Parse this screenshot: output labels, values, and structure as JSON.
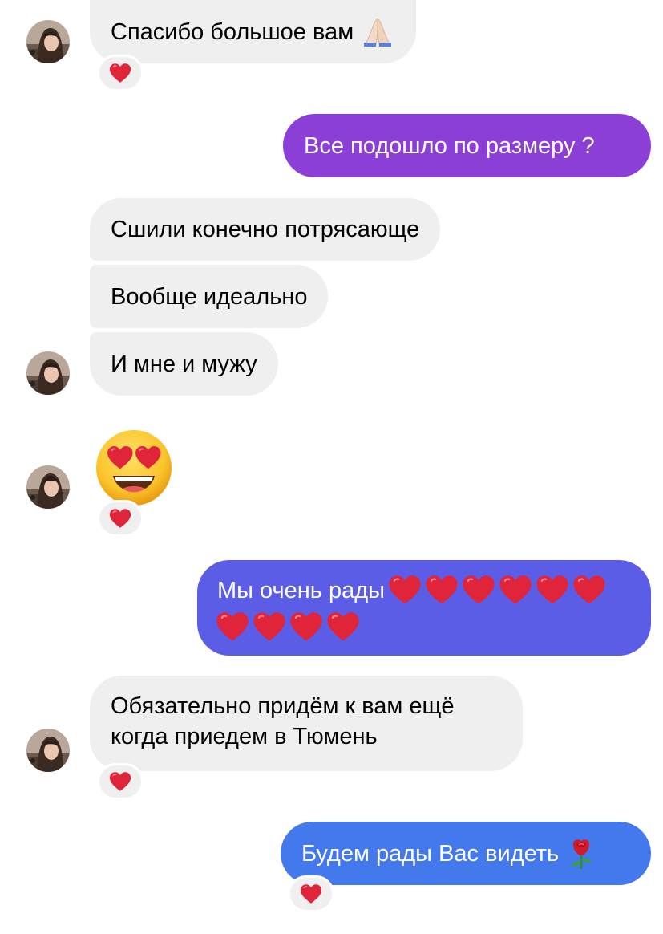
{
  "colors": {
    "incoming_bubble": "#efefef",
    "outgoing_purple": "#8b3fd6",
    "outgoing_indigo": "#5b5de6",
    "outgoing_blue": "#4479ee",
    "heart": "#e0243a"
  },
  "messages": [
    {
      "id": "m1",
      "direction": "incoming",
      "text": "Спасибо большое вам",
      "emoji": "folded-hands-icon",
      "reaction": "heart"
    },
    {
      "id": "m2",
      "direction": "outgoing",
      "text": "Все подошло по размеру ?"
    },
    {
      "id": "m3",
      "direction": "incoming",
      "text": "Сшили конечно потрясающе"
    },
    {
      "id": "m4",
      "direction": "incoming",
      "text": "Вообще идеально"
    },
    {
      "id": "m5",
      "direction": "incoming",
      "text": "И мне и мужу"
    },
    {
      "id": "m6",
      "direction": "incoming",
      "emoji": "heart-eyes-face-icon",
      "reaction": "heart"
    },
    {
      "id": "m7",
      "direction": "outgoing",
      "text": "Мы очень рады",
      "heart_count": 10
    },
    {
      "id": "m8",
      "direction": "incoming",
      "text_line1": "Обязательно придём к вам ещё",
      "text_line2": "когда приедем в Тюмень",
      "reaction": "heart"
    },
    {
      "id": "m9",
      "direction": "outgoing",
      "text": "Будем рады Вас видеть",
      "emoji": "rose-icon",
      "reaction": "heart"
    }
  ]
}
